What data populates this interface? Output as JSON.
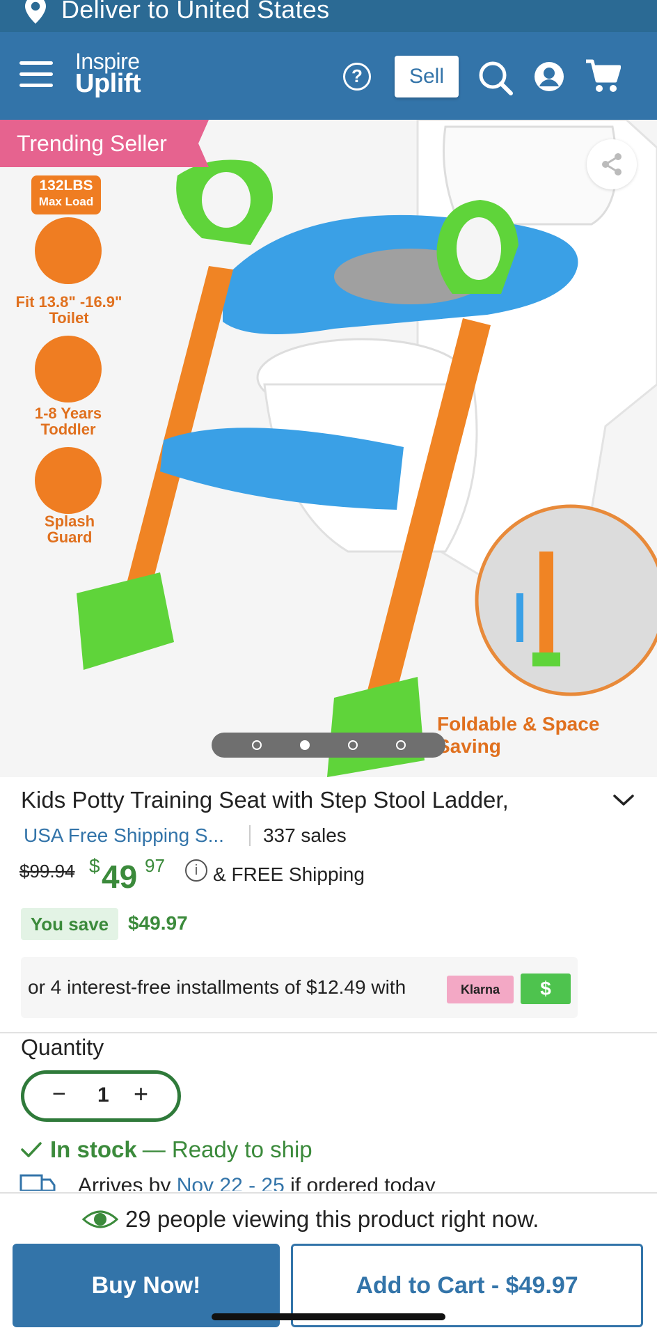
{
  "deliver": {
    "text": "Deliver to United States"
  },
  "header": {
    "logo_line1": "Inspire",
    "logo_line2": "Uplift",
    "help_label": "?",
    "sell_label": "Sell"
  },
  "product_image": {
    "badge": "Trending Seller",
    "max_load": "132LBS",
    "max_load_sub": "Max Load",
    "features": [
      {
        "label": "Fit 13.8\" -16.9\" Toilet"
      },
      {
        "label": "1-8 Years Toddler"
      },
      {
        "label": "Splash Guard"
      }
    ],
    "foldable": "Foldable & Space Saving",
    "carousel_count": 4,
    "carousel_active": 1
  },
  "product": {
    "title": "Kids Potty Training Seat with Step Stool Ladder,",
    "shipping_link": "USA Free Shipping S...",
    "sales": "337 sales",
    "old_price": "$99.94",
    "price_sign": "$",
    "price_main": "49",
    "price_cents": "97",
    "info_icon": "i",
    "free_shipping": "& FREE Shipping",
    "save_label": "You save",
    "save_amount": "$49.97"
  },
  "klarna": {
    "text": "or 4 interest-free installments of $12.49 with",
    "logo": "Klarna",
    "dollar": "$"
  },
  "quantity": {
    "label": "Quantity",
    "minus": "−",
    "value": "1",
    "plus": "+"
  },
  "stock": {
    "status": "In stock",
    "detail": "— Ready to ship"
  },
  "arrives": {
    "prefix": "Arrives by",
    "dates": "Nov 22 - 25",
    "suffix": "if ordered today"
  },
  "bottom": {
    "viewing": "29 people viewing this product right now.",
    "buy_now": "Buy Now!",
    "add_to_cart": "Add to Cart - $49.97"
  },
  "colors": {
    "brand_blue": "#3374a9",
    "price_green": "#3b8a3b",
    "badge_pink": "#e6638f",
    "klarna_pink": "#f3a8c5",
    "accent_orange": "#ef7d22"
  }
}
